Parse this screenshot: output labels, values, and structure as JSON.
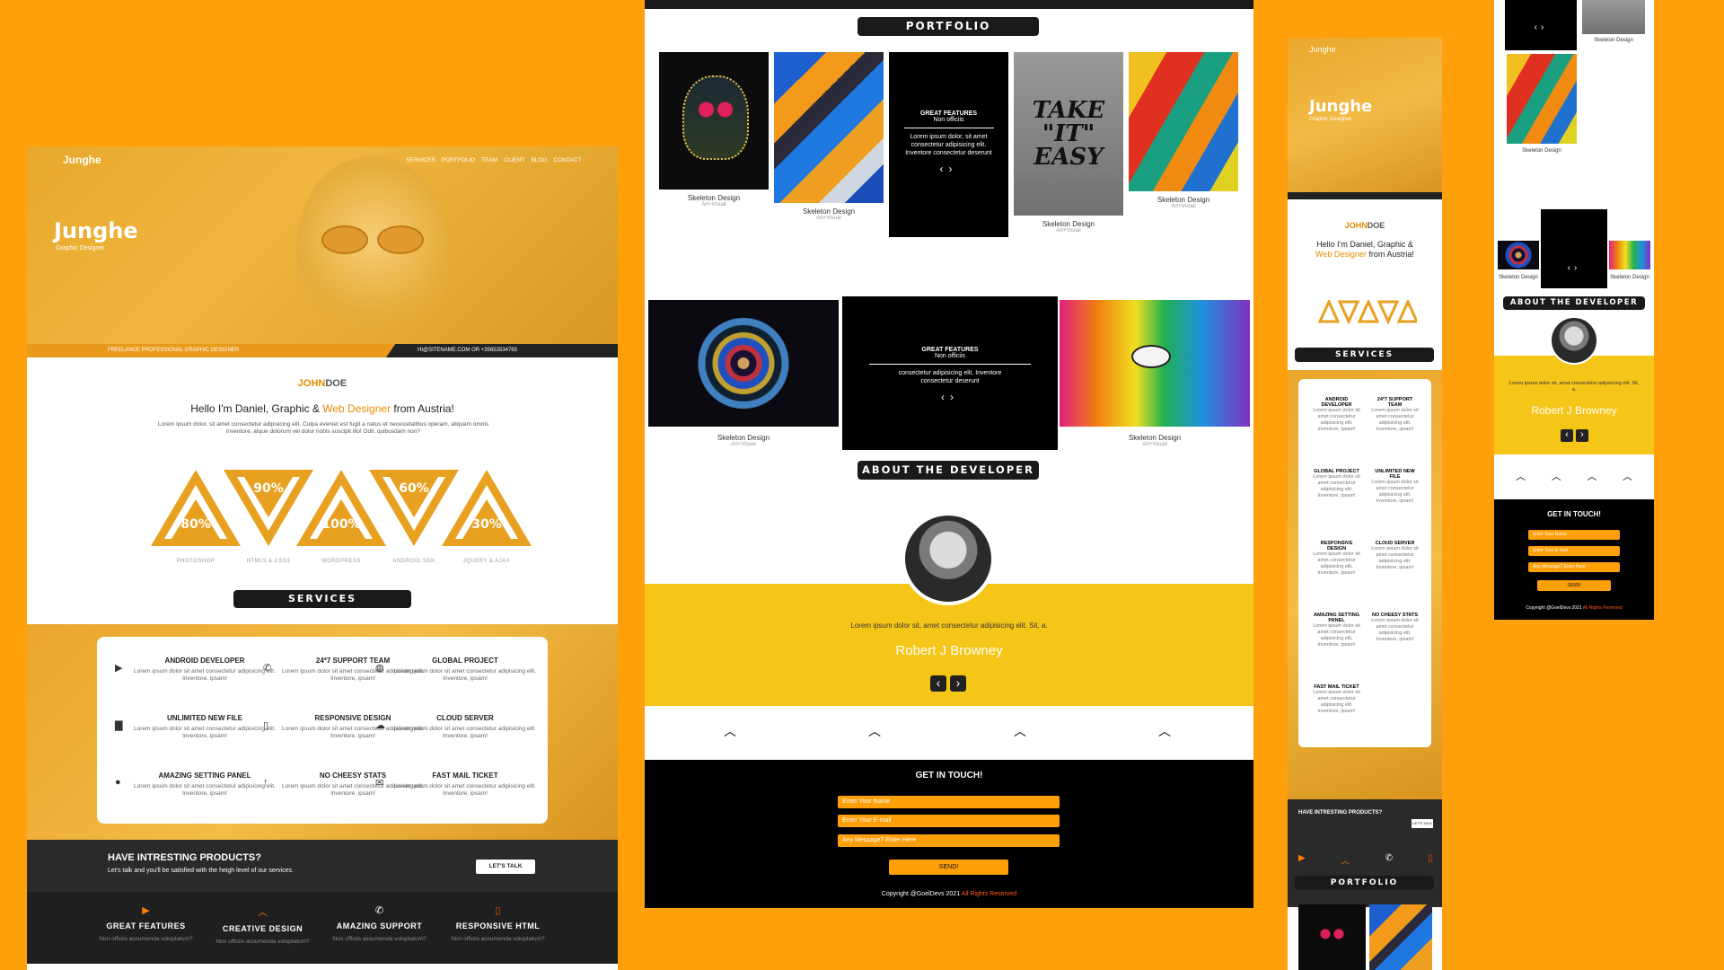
{
  "colors": {
    "background": "#ff9f0a",
    "accent": "#e88a00",
    "dark": "#1a1a1a",
    "yellow": "#f5c518"
  },
  "desktop": {
    "logo": "Junghe",
    "nav": [
      "SERVICES",
      "PORTFOLIO",
      "TEAM",
      "CLIENT",
      "BLOG",
      "CONTACT"
    ],
    "hero_title": "Junghe",
    "hero_subtitle": "Graphic Designer",
    "bar_left": "FREELANCE PROFESSIONAL GRAPHIC DESIGNER",
    "bar_right": "HI@SITENAME.COM OR +35653534765",
    "name_first": "JOHN",
    "name_last": "DOE",
    "intro_pre": "Hello I'm Daniel, Graphic & ",
    "intro_highlight": "Web Designer",
    "intro_post": " from Austria!",
    "intro_text": "Lorem ipsum dolor, sit amet consectetur adipisicing elit. Culpa eveniet est fugit a natus et necessitatibus operam, aliquam omnis inventore, atque dolorum vel dolor nobis suscipit illo! Odit, quibusdam non?",
    "skills": [
      {
        "value": "80%",
        "label": "PHOTOSHOP",
        "dir": "up"
      },
      {
        "value": "90%",
        "label": "HTML5 & CSS3",
        "dir": "down"
      },
      {
        "value": "100%",
        "label": "WORDPRESS",
        "dir": "up"
      },
      {
        "value": "60%",
        "label": "ANDROID SDK",
        "dir": "down"
      },
      {
        "value": "30%",
        "label": "JQUERY & AJAX",
        "dir": "up"
      }
    ],
    "services_heading": "SERVICES",
    "services": [
      {
        "icon": "play-icon",
        "title": "ANDROID DEVELOPER",
        "text": "Lorem ipsum dolor sit amet consectetur adipisicing elit. Inventore, ipsam!"
      },
      {
        "icon": "phone-icon",
        "title": "24*7 SUPPORT TEAM",
        "text": "Lorem ipsum dolor sit amet consectetur adipisicing elit. Inventore, ipsam!"
      },
      {
        "icon": "globe-icon",
        "title": "GLOBAL PROJECT",
        "text": "Lorem ipsum dolor sit amet consectetur adipisicing elit. Inventore, ipsam!"
      },
      {
        "icon": "file-icon",
        "title": "UNLIMITED NEW FILE",
        "text": "Lorem ipsum dolor sit amet consectetur adipisicing elit. Inventore, ipsam!"
      },
      {
        "icon": "mobile-icon",
        "title": "RESPONSIVE DESIGN",
        "text": "Lorem ipsum dolor sit amet consectetur adipisicing elit. Inventore, ipsam!"
      },
      {
        "icon": "cloud-icon",
        "title": "CLOUD SERVER",
        "text": "Lorem ipsum dolor sit amet consectetur adipisicing elit. Inventore, ipsam!"
      },
      {
        "icon": "drop-icon",
        "title": "AMAZING SETTING PANEL",
        "text": "Lorem ipsum dolor sit amet consectetur adipisicing elit. Inventore, ipsam!"
      },
      {
        "icon": "arrow-up-icon",
        "title": "NO CHEESY STATS",
        "text": "Lorem ipsum dolor sit amet consectetur adipisicing elit. Inventore, ipsam!"
      },
      {
        "icon": "mail-icon",
        "title": "FAST MAIL TICKET",
        "text": "Lorem ipsum dolor sit amet consectetur adipisicing elit. Inventore, ipsam!"
      }
    ],
    "promo_title": "HAVE INTRESTING PRODUCTS?",
    "promo_text": "Let's talk and you'll be satisfied with the heigh level of our services.",
    "promo_button": "LET'S TALK",
    "features": [
      {
        "icon": "play-icon",
        "title": "GREAT FEATURES",
        "sub": "Non officiis assumenda voluptatum?"
      },
      {
        "icon": "chevron-up-icon",
        "title": "CREATIVE DESIGN",
        "sub": "Non officiis assumenda voluptatum?"
      },
      {
        "icon": "phone-icon",
        "title": "AMAZING SUPPORT",
        "sub": "Non officiis assumenda voluptatum?"
      },
      {
        "icon": "mobile-icon",
        "title": "RESPONSIVE HTML",
        "sub": "Non officiis assumenda voluptatum?"
      }
    ]
  },
  "tablet": {
    "portfolio_heading": "PORTFOLIO",
    "items": [
      {
        "caption": "Skeleton Design",
        "sub": "Art+Visual"
      },
      {
        "caption": "Skeleton Design",
        "sub": "Art+Visual"
      },
      {
        "caption": "Skeleton Design",
        "sub": "Art+Visual"
      },
      {
        "caption": "Skeleton Design",
        "sub": "Art+Visual"
      },
      {
        "caption": "Skeleton Design",
        "sub": "Art+Visual"
      },
      {
        "caption": "Skeleton Design",
        "sub": "Art+Visual"
      }
    ],
    "feature_card1": {
      "title": "GREAT FEATURES",
      "sub": "Non officiis",
      "text": "Lorem ipsum dolor, sit amet consectetur adipisicing elit. Inventore consectetur deserunt"
    },
    "feature_card2": {
      "title": "GREAT FEATURES",
      "sub": "Non officiis",
      "text": "consectetur adipisicing elit. Inventore consectetur deserunt"
    },
    "about_heading": "ABOUT THE DEVELOPER",
    "quote": "Lorem ipsum dolor sit, amet consectetur adipisicing elit. Sit, a.",
    "dev_name": "Robert J Browney",
    "contact_title": "GET IN TOUCH!",
    "inputs": [
      "Enter Your Name",
      "Enter Your E-mail",
      "Any Message? Enter Here"
    ],
    "send": "SEND!",
    "copyright": "Copyright @GoelDevs 2021",
    "rights": "All Rights Reserved"
  },
  "mobile": {
    "logo": "Junghe",
    "hero_title": "Junghe",
    "hero_subtitle": "Graphic Designer",
    "name_first": "JOHN",
    "name_last": "DOE",
    "intro_l1": "Hello I'm Daniel, Graphic &",
    "intro_highlight": "Web Designer",
    "intro_post": " from Austria!",
    "services_heading": "SERVICES",
    "promo_title": "HAVE INTRESTING PRODUCTS?",
    "promo_btn": "LET'S TALK",
    "portfolio_heading": "PORTFOLIO"
  },
  "mobile2": {
    "captions": [
      "Skeleton Design",
      "Skeleton Design",
      "Skeleton Design",
      "Skeleton Design"
    ],
    "about_heading": "ABOUT THE DEVELOPER",
    "dev_name": "Robert J Browney",
    "quote": "Lorem ipsum dolor sit, amet consectetur adipisicing elit. Sit, a.",
    "contact_title": "GET IN TOUCH!",
    "inputs": [
      "Enter Your Name",
      "Enter Your E-mail",
      "Any Message? Enter Here"
    ],
    "send": "SEND!",
    "copyright": "Copyright @GoelDevs 2021",
    "rights": "All Rights Reserved"
  }
}
